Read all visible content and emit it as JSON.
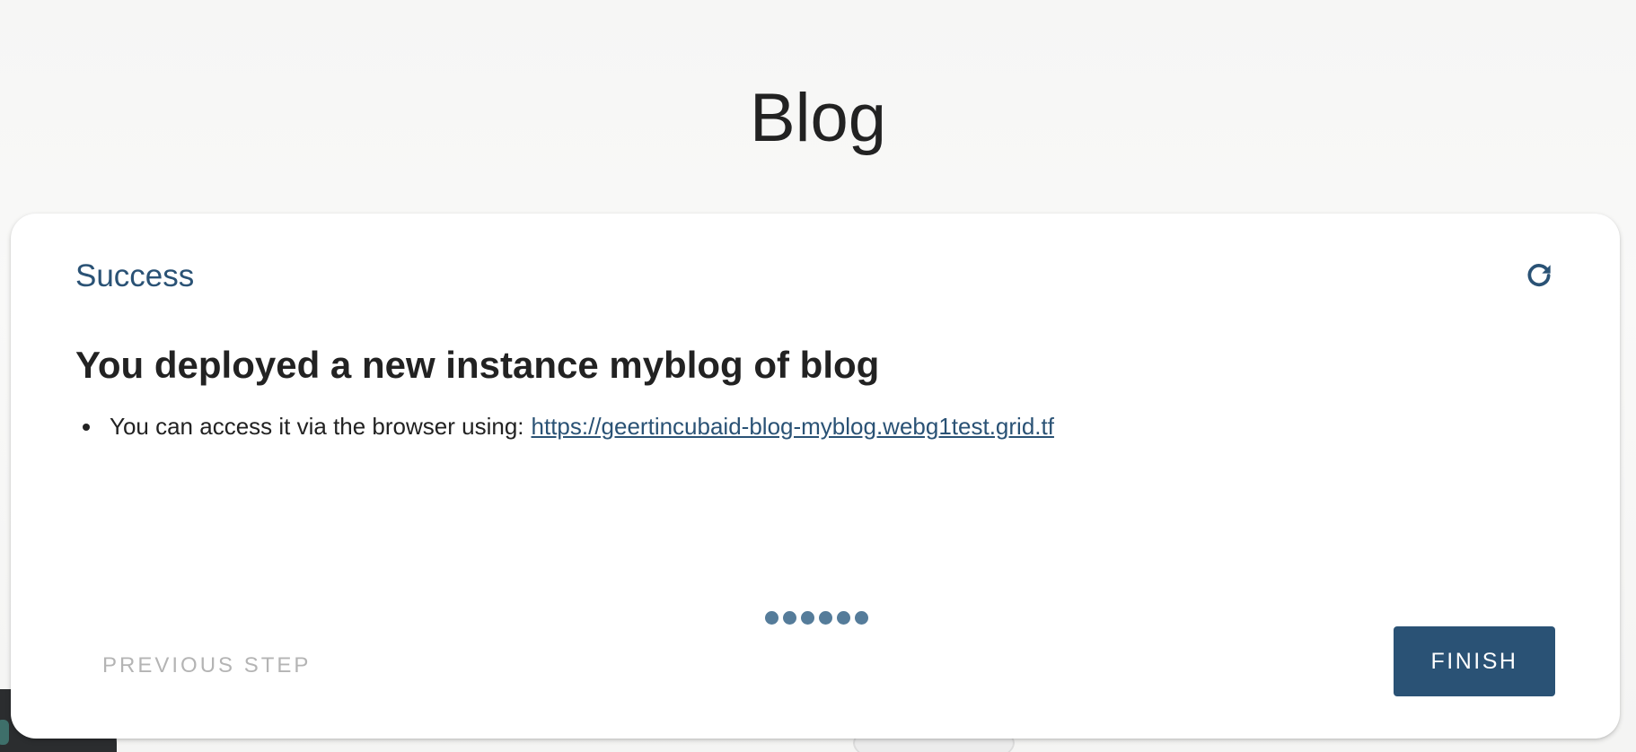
{
  "page": {
    "title": "Blog"
  },
  "card": {
    "step_title": "Success",
    "headline": "You deployed a new instance myblog of blog",
    "info_items": [
      {
        "text": "You can access it via the browser using:",
        "link": "https://geertincubaid-blog-myblog.webg1test.grid.tf"
      }
    ],
    "refresh_icon": "refresh-icon",
    "stepper": {
      "total_steps": 6,
      "dot_color": "#557c9a"
    },
    "prev_button_label": "PREVIOUS STEP",
    "finish_button_label": "FINISH"
  },
  "colors": {
    "accent": "#2a5275",
    "disabled_text": "#b4b4b4",
    "heading_text": "#222222"
  }
}
